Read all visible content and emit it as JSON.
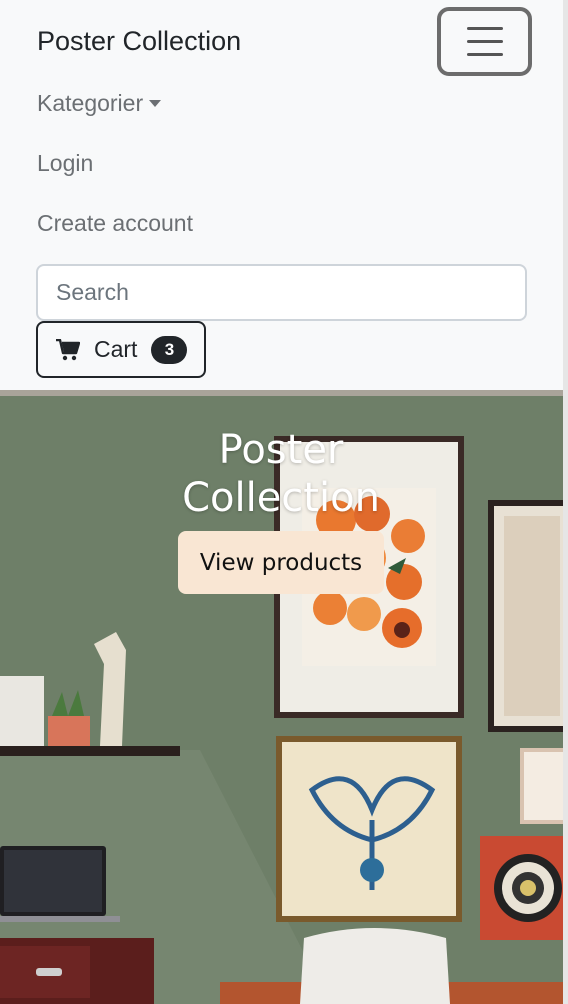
{
  "navbar": {
    "brand": "Poster Collection",
    "links": {
      "categories": "Kategorier",
      "login": "Login",
      "create_account": "Create account"
    },
    "search": {
      "placeholder": "Search",
      "value": ""
    },
    "cart": {
      "label": "Cart",
      "count": "3"
    }
  },
  "hero": {
    "title": "Poster Collection",
    "button": "View products"
  },
  "colors": {
    "navbar_bg": "#f8f9fa",
    "wall_green": "#6e7f68",
    "button_bg": "#f9e6d3",
    "dark": "#212529"
  },
  "icons": [
    "menu-icon",
    "caret-down-icon",
    "cart-icon"
  ]
}
